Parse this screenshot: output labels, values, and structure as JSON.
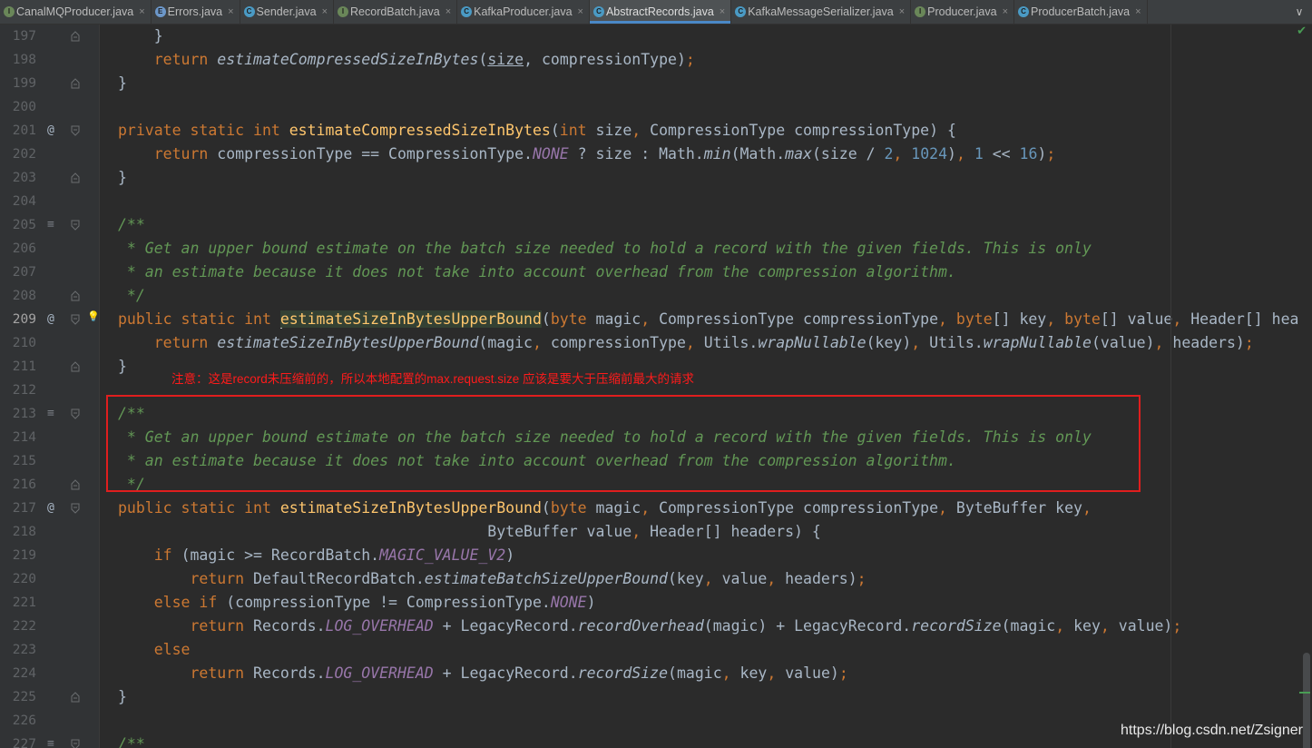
{
  "tabs": [
    {
      "label": "CanalMQProducer.java",
      "icon": "interface-icon",
      "color": "#6a8759",
      "glyph": "I",
      "active": false
    },
    {
      "label": "Errors.java",
      "icon": "enum-icon",
      "color": "#6c97c9",
      "glyph": "E",
      "active": false
    },
    {
      "label": "Sender.java",
      "icon": "class-icon",
      "color": "#4a9ac4",
      "glyph": "C",
      "active": false
    },
    {
      "label": "RecordBatch.java",
      "icon": "interface-icon",
      "color": "#6a8759",
      "glyph": "I",
      "active": false
    },
    {
      "label": "KafkaProducer.java",
      "icon": "class-icon",
      "color": "#4a9ac4",
      "glyph": "C",
      "active": false
    },
    {
      "label": "AbstractRecords.java",
      "icon": "abstract-class-icon",
      "color": "#4a9ac4",
      "glyph": "C",
      "active": true
    },
    {
      "label": "KafkaMessageSerializer.java",
      "icon": "class-icon",
      "color": "#4a9ac4",
      "glyph": "C",
      "active": false
    },
    {
      "label": "Producer.java",
      "icon": "interface-icon",
      "color": "#6a8759",
      "glyph": "I",
      "active": false
    },
    {
      "label": "ProducerBatch.java",
      "icon": "class-icon",
      "color": "#4a9ac4",
      "glyph": "C",
      "active": false
    }
  ],
  "tab_close_glyph": "×",
  "tab_menu_glyph": "∨",
  "line_numbers": [
    "197",
    "198",
    "199",
    "200",
    "201",
    "202",
    "203",
    "204",
    "205",
    "206",
    "207",
    "208",
    "209",
    "210",
    "211",
    "212",
    "213",
    "214",
    "215",
    "216",
    "217",
    "218",
    "219",
    "220",
    "221",
    "222",
    "223",
    "224",
    "225",
    "226",
    "227"
  ],
  "current_line": "209",
  "gutter_marks": {
    "override_glyph": "@",
    "doc_glyph": "≡",
    "bulb_glyph": "💡"
  },
  "code_lines": [
    [
      {
        "t": "    }"
      }
    ],
    [
      {
        "t": "    "
      },
      {
        "t": "return ",
        "c": "kw"
      },
      {
        "t": "estimateCompressedSizeInBytes",
        "c": "it"
      },
      {
        "t": "("
      },
      {
        "t": "size",
        "c": "ul"
      },
      {
        "t": ", compressionType)"
      },
      {
        "t": ";",
        "c": "kw"
      }
    ],
    [
      {
        "t": "}"
      }
    ],
    [
      {
        "t": ""
      }
    ],
    [
      {
        "t": "private static int ",
        "c": "kw"
      },
      {
        "t": "estimateCompressedSizeInBytes",
        "c": "fn"
      },
      {
        "t": "("
      },
      {
        "t": "int ",
        "c": "kw"
      },
      {
        "t": "size"
      },
      {
        "t": ", ",
        "c": "kw"
      },
      {
        "t": "CompressionType compressionType) {"
      }
    ],
    [
      {
        "t": "    "
      },
      {
        "t": "return ",
        "c": "kw"
      },
      {
        "t": "compressionType == CompressionType."
      },
      {
        "t": "NONE",
        "c": "st"
      },
      {
        "t": " ? size : Math."
      },
      {
        "t": "min",
        "c": "it"
      },
      {
        "t": "(Math."
      },
      {
        "t": "max",
        "c": "it"
      },
      {
        "t": "(size / "
      },
      {
        "t": "2",
        "c": "num"
      },
      {
        "t": ", ",
        "c": "kw"
      },
      {
        "t": "1024",
        "c": "num"
      },
      {
        "t": ")"
      },
      {
        "t": ", ",
        "c": "kw"
      },
      {
        "t": "1",
        "c": "num"
      },
      {
        "t": " << "
      },
      {
        "t": "16",
        "c": "num"
      },
      {
        "t": ")"
      },
      {
        "t": ";",
        "c": "kw"
      }
    ],
    [
      {
        "t": "}"
      }
    ],
    [
      {
        "t": ""
      }
    ],
    [
      {
        "t": "/**",
        "c": "cm"
      }
    ],
    [
      {
        "t": " * Get an upper bound estimate on the batch size needed to hold a record with the given fields. This is only",
        "c": "cm"
      }
    ],
    [
      {
        "t": " * an estimate because it does not take into account overhead from the compression algorithm.",
        "c": "cm"
      }
    ],
    [
      {
        "t": " */",
        "c": "cm"
      }
    ],
    [
      {
        "t": "public static int ",
        "c": "kw"
      },
      {
        "t": "CARET",
        "c": "caret"
      },
      {
        "t": "estimateSizeInBytesUpperBound",
        "c": "fn hl"
      },
      {
        "t": "("
      },
      {
        "t": "byte ",
        "c": "kw"
      },
      {
        "t": "magic"
      },
      {
        "t": ", ",
        "c": "kw"
      },
      {
        "t": "CompressionType compressionType"
      },
      {
        "t": ", ",
        "c": "kw"
      },
      {
        "t": "byte",
        "c": "kw"
      },
      {
        "t": "[] key"
      },
      {
        "t": ", ",
        "c": "kw"
      },
      {
        "t": "byte",
        "c": "kw"
      },
      {
        "t": "[] value"
      },
      {
        "t": ", ",
        "c": "kw"
      },
      {
        "t": "Header[] headers) {"
      }
    ],
    [
      {
        "t": "    "
      },
      {
        "t": "return ",
        "c": "kw"
      },
      {
        "t": "estimateSizeInBytesUpperBound",
        "c": "it"
      },
      {
        "t": "(magic"
      },
      {
        "t": ", ",
        "c": "kw"
      },
      {
        "t": "compressionType"
      },
      {
        "t": ", ",
        "c": "kw"
      },
      {
        "t": "Utils."
      },
      {
        "t": "wrapNullable",
        "c": "it"
      },
      {
        "t": "(key)"
      },
      {
        "t": ", ",
        "c": "kw"
      },
      {
        "t": "Utils."
      },
      {
        "t": "wrapNullable",
        "c": "it"
      },
      {
        "t": "(value)"
      },
      {
        "t": ", ",
        "c": "kw"
      },
      {
        "t": "headers)"
      },
      {
        "t": ";",
        "c": "kw"
      }
    ],
    [
      {
        "t": "}"
      }
    ],
    [
      {
        "t": ""
      }
    ],
    [
      {
        "t": "/**",
        "c": "cm"
      }
    ],
    [
      {
        "t": " * Get an upper bound estimate on the batch size needed to hold a record with the given fields. This is only",
        "c": "cm"
      }
    ],
    [
      {
        "t": " * an estimate because it does not take into account overhead from the compression algorithm.",
        "c": "cm"
      }
    ],
    [
      {
        "t": " */",
        "c": "cm"
      }
    ],
    [
      {
        "t": "public static int ",
        "c": "kw"
      },
      {
        "t": "estimateSizeInBytesUpperBound",
        "c": "fn"
      },
      {
        "t": "("
      },
      {
        "t": "byte ",
        "c": "kw"
      },
      {
        "t": "magic"
      },
      {
        "t": ", ",
        "c": "kw"
      },
      {
        "t": "CompressionType compressionType"
      },
      {
        "t": ", ",
        "c": "kw"
      },
      {
        "t": "ByteBuffer key"
      },
      {
        "t": ",",
        "c": "kw"
      }
    ],
    [
      {
        "t": "                                         ByteBuffer value"
      },
      {
        "t": ", ",
        "c": "kw"
      },
      {
        "t": "Header[] headers) {"
      }
    ],
    [
      {
        "t": "    "
      },
      {
        "t": "if ",
        "c": "kw"
      },
      {
        "t": "(magic >= RecordBatch."
      },
      {
        "t": "MAGIC_VALUE_V2",
        "c": "st"
      },
      {
        "t": ")"
      }
    ],
    [
      {
        "t": "        "
      },
      {
        "t": "return ",
        "c": "kw"
      },
      {
        "t": "DefaultRecordBatch."
      },
      {
        "t": "estimateBatchSizeUpperBound",
        "c": "it"
      },
      {
        "t": "(key"
      },
      {
        "t": ", ",
        "c": "kw"
      },
      {
        "t": "value"
      },
      {
        "t": ", ",
        "c": "kw"
      },
      {
        "t": "headers)"
      },
      {
        "t": ";",
        "c": "kw"
      }
    ],
    [
      {
        "t": "    "
      },
      {
        "t": "else if ",
        "c": "kw"
      },
      {
        "t": "(compressionType != CompressionType."
      },
      {
        "t": "NONE",
        "c": "st"
      },
      {
        "t": ")"
      }
    ],
    [
      {
        "t": "        "
      },
      {
        "t": "return ",
        "c": "kw"
      },
      {
        "t": "Records."
      },
      {
        "t": "LOG_OVERHEAD",
        "c": "st"
      },
      {
        "t": " + LegacyRecord."
      },
      {
        "t": "recordOverhead",
        "c": "it"
      },
      {
        "t": "(magic) + LegacyRecord."
      },
      {
        "t": "recordSize",
        "c": "it"
      },
      {
        "t": "(magic"
      },
      {
        "t": ", ",
        "c": "kw"
      },
      {
        "t": "key"
      },
      {
        "t": ", ",
        "c": "kw"
      },
      {
        "t": "value)"
      },
      {
        "t": ";",
        "c": "kw"
      }
    ],
    [
      {
        "t": "    "
      },
      {
        "t": "else",
        "c": "kw"
      }
    ],
    [
      {
        "t": "        "
      },
      {
        "t": "return ",
        "c": "kw"
      },
      {
        "t": "Records."
      },
      {
        "t": "LOG_OVERHEAD",
        "c": "st"
      },
      {
        "t": " + LegacyRecord."
      },
      {
        "t": "recordSize",
        "c": "it"
      },
      {
        "t": "(magic"
      },
      {
        "t": ", ",
        "c": "kw"
      },
      {
        "t": "key"
      },
      {
        "t": ", ",
        "c": "kw"
      },
      {
        "t": "value)"
      },
      {
        "t": ";",
        "c": "kw"
      }
    ],
    [
      {
        "t": "}"
      }
    ],
    [
      {
        "t": ""
      }
    ],
    [
      {
        "t": "/**",
        "c": "cm"
      }
    ]
  ],
  "annotation": "注意：这是record未压缩前的，所以本地配置的max.request.size 应该是要大于压缩前最大的请求",
  "watermark": "https://blog.csdn.net/Zsigner",
  "inspection_glyph": "✔",
  "colors": {
    "accent": "#4a88c7",
    "annotation": "#ff1b1b",
    "comment": "#629755",
    "keyword": "#cc7832",
    "method": "#ffc66d"
  }
}
